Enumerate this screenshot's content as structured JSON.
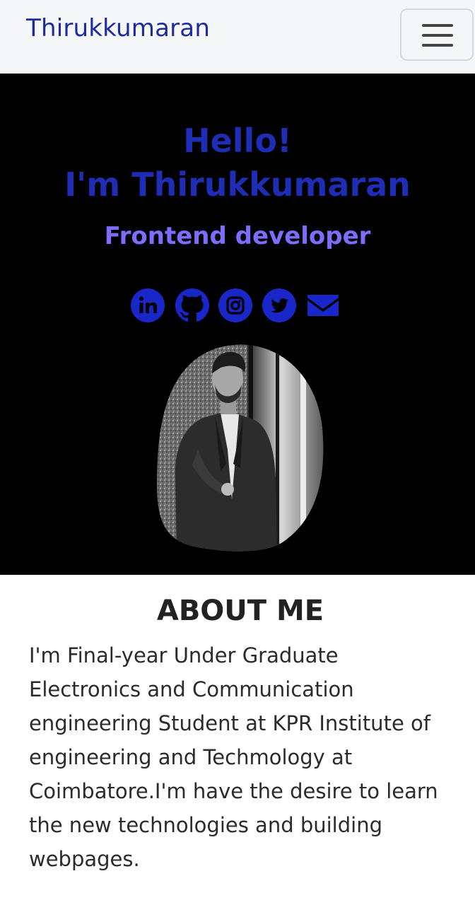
{
  "navbar": {
    "brand": "Thirukkumaran",
    "toggler_icon": "hamburger-menu-icon"
  },
  "hero": {
    "greeting_line1": "Hello!",
    "greeting_line2": "I'm Thirukkumaran",
    "role": "Frontend developer",
    "social_icons": [
      "linkedin-icon",
      "github-icon",
      "instagram-icon",
      "twitter-icon",
      "email-icon"
    ],
    "colors": {
      "greeting": "#1f2cb4",
      "role": "#7c6dfc",
      "icons": "#1a27c8",
      "background": "#000000"
    }
  },
  "about": {
    "title": "ABOUT ME",
    "text": "I'm Final-year Under Graduate Electronics and Communication engineering Student at KPR Institute of engineering and Techmology at Coimbatore.I'm have the desire to learn the new technologies and building webpages."
  }
}
